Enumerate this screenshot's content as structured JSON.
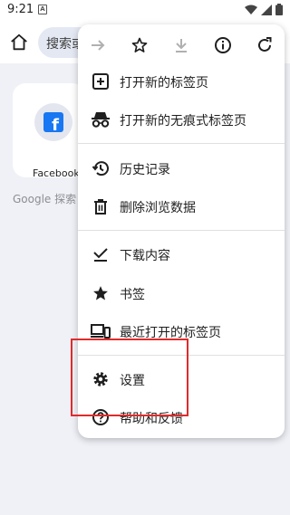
{
  "status_bar": {
    "time": "9:21",
    "notification_letter": "A"
  },
  "toolbar": {
    "omnibox_text": "搜索或"
  },
  "ntp": {
    "tile_label": "Facebook",
    "tile_icon_letter": "f",
    "search_hint": "Google 探索"
  },
  "menu": {
    "items": [
      {
        "label": "打开新的标签页"
      },
      {
        "label": "打开新的无痕式标签页"
      },
      {
        "label": "历史记录"
      },
      {
        "label": "删除浏览数据"
      },
      {
        "label": "下载内容"
      },
      {
        "label": "书签"
      },
      {
        "label": "最近打开的标签页"
      },
      {
        "label": "设置"
      },
      {
        "label": "帮助和反馈"
      }
    ]
  },
  "colors": {
    "highlight": "#e02b2b",
    "facebook_blue": "#1877f2",
    "icon_dark": "#1f1f1f",
    "icon_disabled": "#b0b0b0"
  }
}
